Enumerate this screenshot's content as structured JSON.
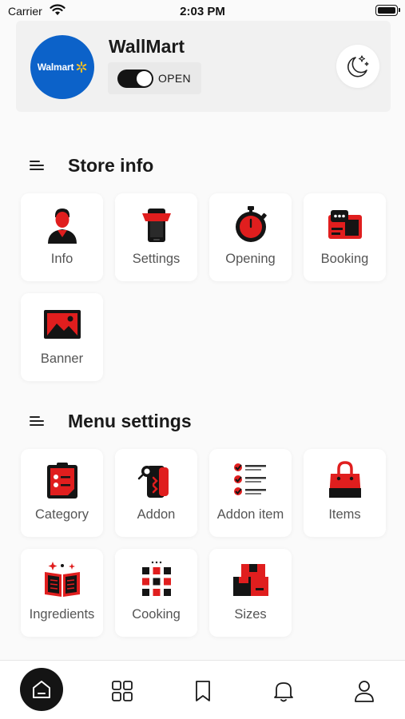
{
  "status_bar": {
    "carrier": "Carrier",
    "time": "2:03 PM"
  },
  "store": {
    "name": "WallMart",
    "logo_text": "Walmart",
    "status_label": "OPEN",
    "is_open": true
  },
  "sections": {
    "store_info": {
      "title": "Store info",
      "items": [
        "Info",
        "Settings",
        "Opening",
        "Booking",
        "Banner"
      ]
    },
    "menu_settings": {
      "title": "Menu settings",
      "items": [
        "Category",
        "Addon",
        "Addon item",
        "Items",
        "Ingredients",
        "Cooking",
        "Sizes"
      ]
    }
  },
  "icons": {
    "header": [
      "walmart-logo",
      "toggle-switch",
      "moon-stars-icon"
    ],
    "store_info": [
      "user-icon",
      "phone-icon",
      "stopwatch-icon",
      "booking-icon",
      "image-icon"
    ],
    "menu_settings": [
      "clipboard-icon",
      "addon-icon",
      "checklist-icon",
      "shopping-bag-icon",
      "recipe-book-icon",
      "cooking-grid-icon",
      "box-icon"
    ],
    "nav": [
      "home-icon",
      "grid-icon",
      "bookmark-icon",
      "bell-icon",
      "user-icon"
    ]
  },
  "bottom_nav": {
    "active": "home"
  },
  "colors": {
    "accent_red": "#e01e1e",
    "dark": "#141414",
    "walmart_blue": "#0c62c9",
    "walmart_yellow": "#ffc220"
  }
}
